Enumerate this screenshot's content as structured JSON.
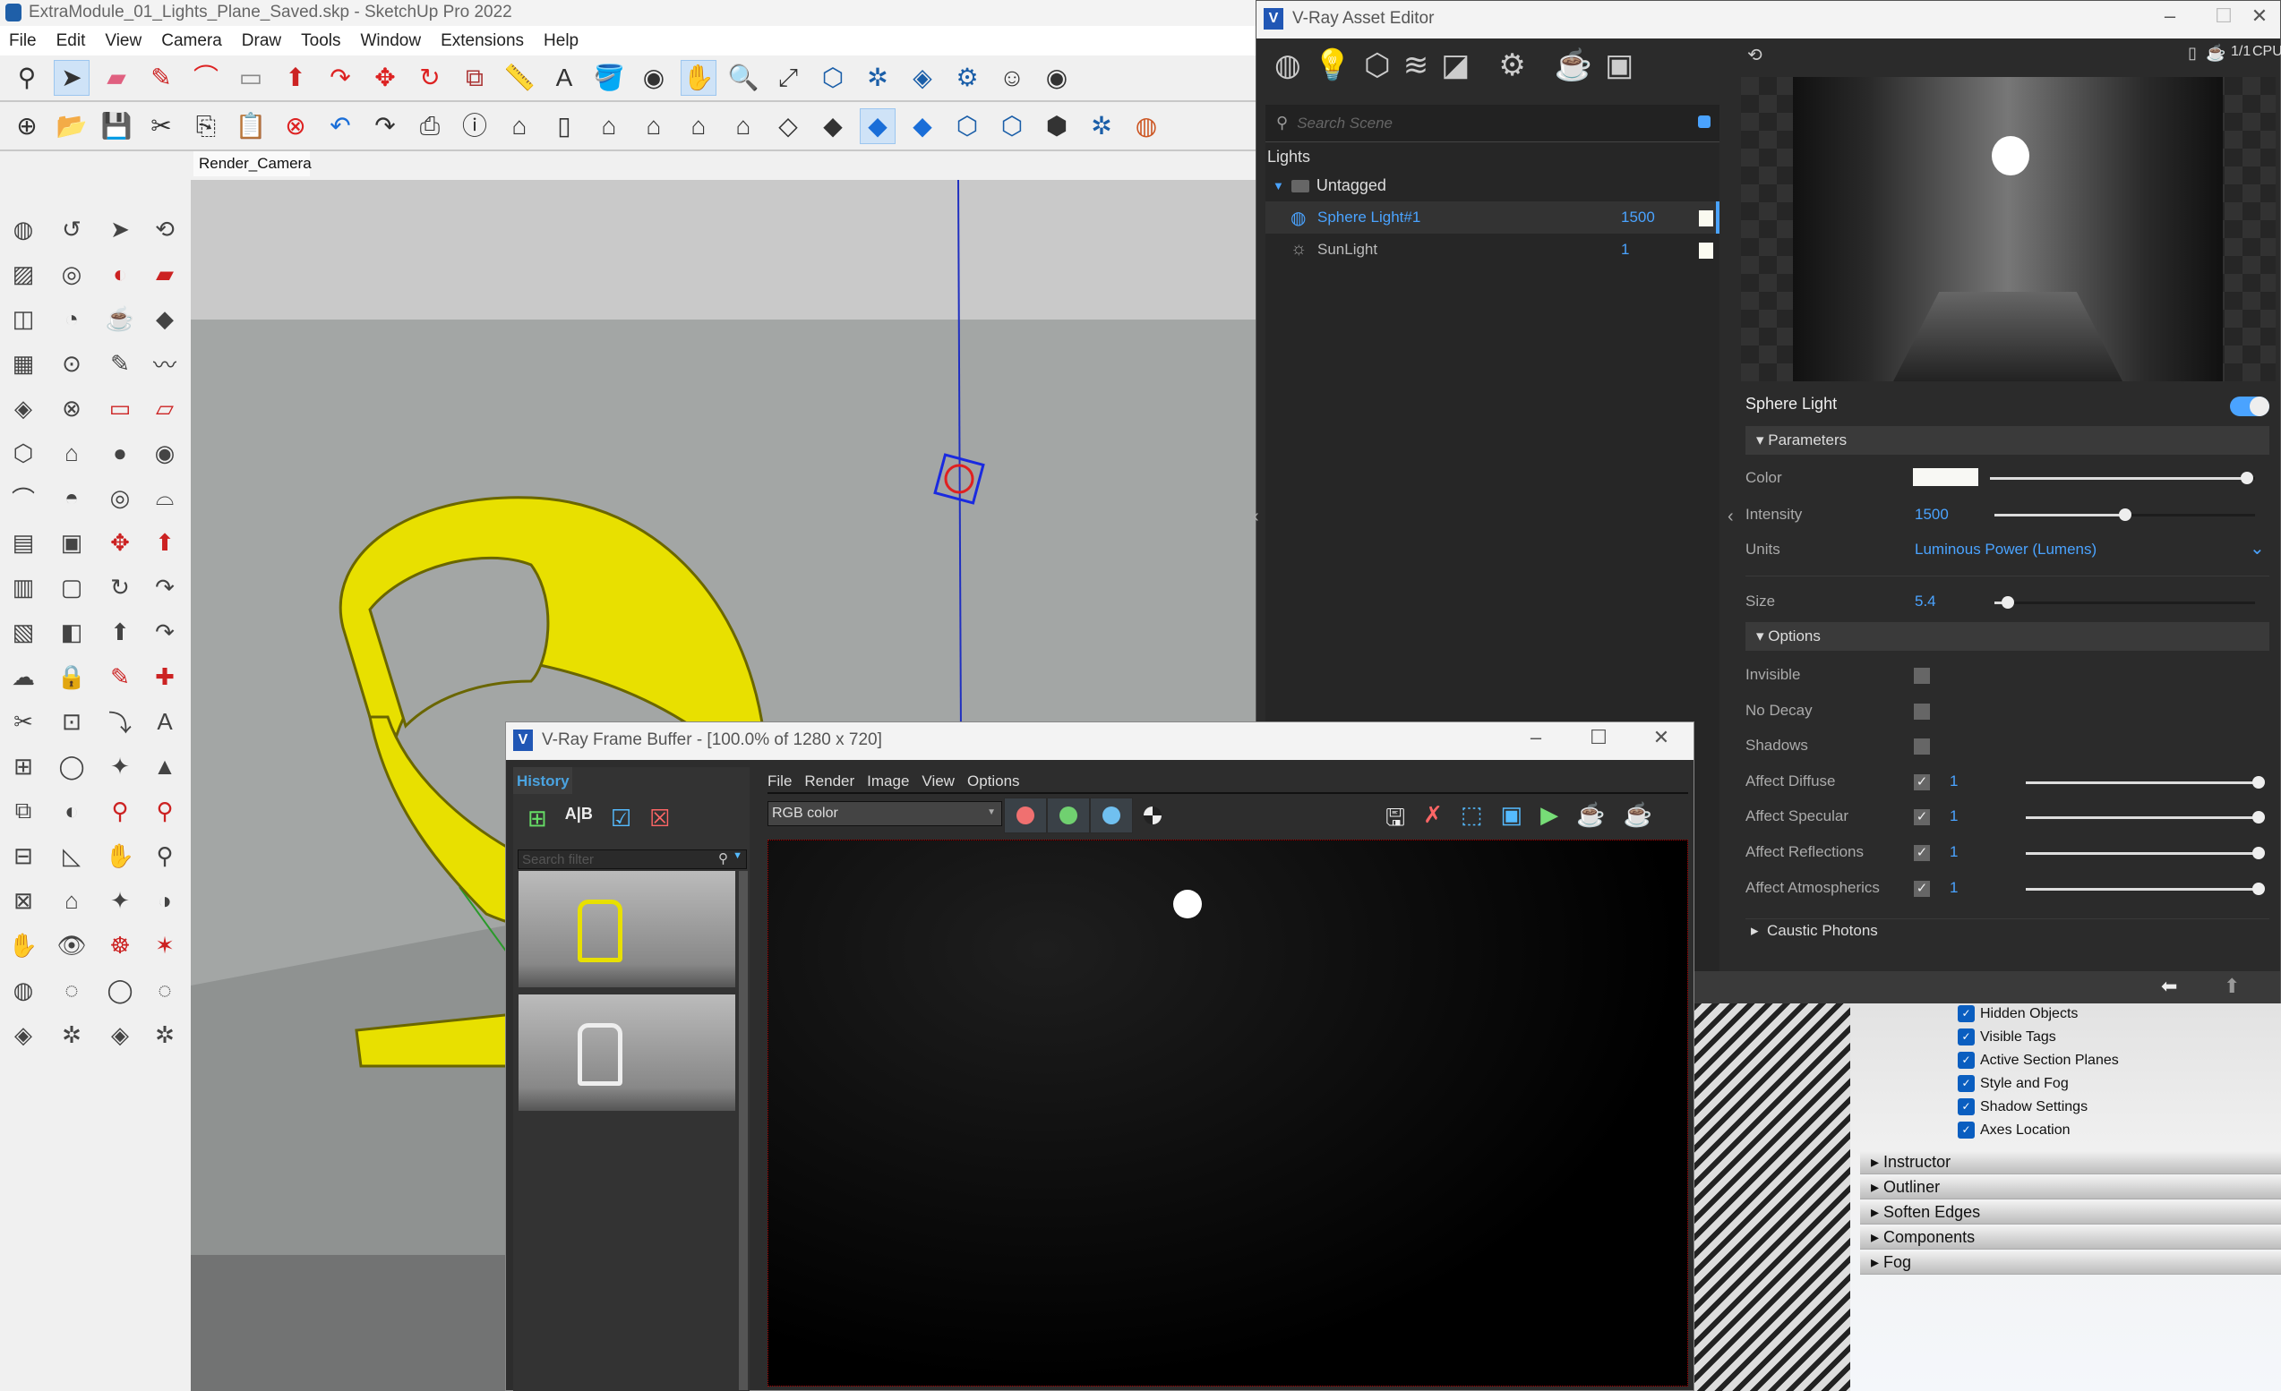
{
  "sketchup": {
    "title": "ExtraModule_01_Lights_Plane_Saved.skp - SketchUp Pro 2022",
    "menu": [
      "File",
      "Edit",
      "View",
      "Camera",
      "Draw",
      "Tools",
      "Window",
      "Extensions",
      "Help"
    ],
    "toolbar1": [
      "zoom-icon",
      "select-icon",
      "eraser-icon",
      "pencil-icon",
      "arc-icon",
      "rectangle-icon",
      "push-pull-icon",
      "follow-me-icon",
      "move-icon",
      "rotate-icon",
      "offset-icon",
      "tape-measure-icon",
      "text-icon",
      "paint-bucket-icon",
      "orbit-icon",
      "pan-icon",
      "zoom-window-icon",
      "zoom-extents-icon",
      "warehouse-icon",
      "extension-warehouse-icon",
      "layout-icon",
      "extension-manager-icon",
      "profile-icon",
      "orbit-icon"
    ],
    "toolbar1_selected": [
      "select-icon",
      "pan-icon"
    ],
    "toolbar2": [
      "new-icon",
      "open-icon",
      "save-icon",
      "cut-icon",
      "copy-icon",
      "paste-icon",
      "delete-icon",
      "undo-icon",
      "redo-icon",
      "print-icon",
      "model-info-icon",
      "iso-view-icon",
      "top-view-icon",
      "front-view-icon",
      "right-view-icon",
      "back-view-icon",
      "left-view-icon",
      "section-plane-icon",
      "section-display-icon",
      "section-cut-icon",
      "section-fill-icon",
      "warehouse-download-icon",
      "warehouse-upload-icon",
      "component-share-icon",
      "extension-warehouse-icon",
      "sandbox-icon"
    ],
    "toolbar2_selected": [
      "section-cut-icon"
    ],
    "scene_tab": "Render_Camera",
    "tray": {
      "checks": [
        "Hidden Objects",
        "Visible Tags",
        "Active Section Planes",
        "Style and Fog",
        "Shadow Settings",
        "Axes Location"
      ],
      "panels": [
        "Instructor",
        "Outliner",
        "Soften Edges",
        "Components",
        "Fog"
      ]
    }
  },
  "asset_editor": {
    "title": "V-Ray Asset Editor",
    "categories": [
      "materials-icon",
      "lights-icon",
      "geometry-icon",
      "render-elements-icon",
      "textures-icon",
      "settings-icon",
      "render-teapot-icon",
      "frame-buffer-icon"
    ],
    "active_category": "lights-icon",
    "search_placeholder": "Search Scene",
    "section": "Lights",
    "group": "Untagged",
    "lights": [
      {
        "name": "Sphere Light#1",
        "value": "1500",
        "selected": true,
        "icon": "sphere-light-icon"
      },
      {
        "name": "SunLight",
        "value": "1",
        "selected": false,
        "icon": "sun-icon"
      }
    ],
    "preview": {
      "ratio": "1/1",
      "engine": "CPU"
    },
    "props": {
      "header": "Sphere Light",
      "enabled": true,
      "parameters_label": "Parameters",
      "color_label": "Color",
      "color_value": "#f8f8f4",
      "color_slider": 0.97,
      "intensity_label": "Intensity",
      "intensity": "1500",
      "intensity_slider": 0.5,
      "units_label": "Units",
      "units": "Luminous Power (Lumens)",
      "size_label": "Size",
      "size": "5.4",
      "size_slider": 0.05,
      "options_label": "Options",
      "options": [
        {
          "label": "Invisible",
          "checked": false
        },
        {
          "label": "No Decay",
          "checked": false
        },
        {
          "label": "Shadows",
          "checked": false
        },
        {
          "label": "Affect Diffuse",
          "checked": true,
          "value": "1",
          "slider": 1
        },
        {
          "label": "Affect Specular",
          "checked": true,
          "value": "1",
          "slider": 1
        },
        {
          "label": "Affect Reflections",
          "checked": true,
          "value": "1",
          "slider": 1
        },
        {
          "label": "Affect Atmospherics",
          "checked": true,
          "value": "1",
          "slider": 1
        }
      ],
      "caustic_label": "Caustic Photons"
    },
    "accent": "#4aa3ff"
  },
  "frame_buffer": {
    "title": "V-Ray Frame Buffer - [100.0% of 1280 x 720]",
    "history_tab": "History",
    "search_placeholder": "Search filter",
    "menu": [
      "File",
      "Render",
      "Image",
      "View",
      "Options"
    ],
    "channel": "RGB color",
    "channel_dots": [
      "#f07070",
      "#70d070",
      "#70c0f0"
    ]
  }
}
